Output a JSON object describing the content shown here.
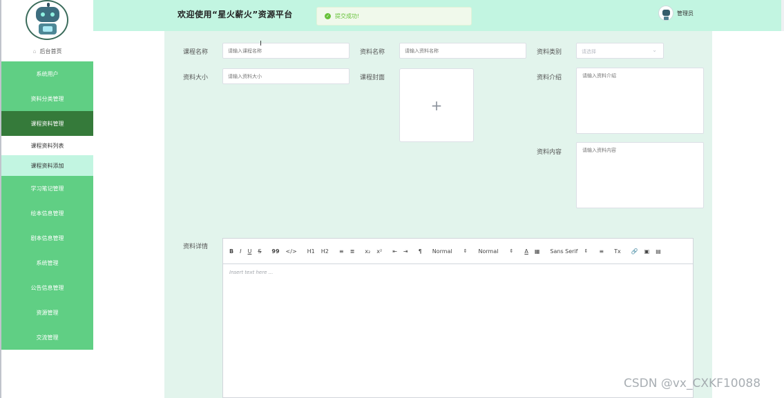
{
  "header": {
    "title": "欢迎使用“星火薪火”资源平台",
    "toast": "提交成功!",
    "user": "管理员"
  },
  "sidebar": {
    "home": "后台首页",
    "menu": [
      {
        "label": "系统用户"
      },
      {
        "label": "资料分类管理"
      },
      {
        "label": "课程资料管理"
      },
      {
        "label": "学习笔记管理"
      },
      {
        "label": "绘本信息管理"
      },
      {
        "label": "剧本信息管理"
      },
      {
        "label": "系统管理"
      },
      {
        "label": "公告信息管理"
      },
      {
        "label": "资源管理"
      },
      {
        "label": "交流管理"
      }
    ],
    "submenu": [
      {
        "label": "课程资料列表"
      },
      {
        "label": "课程资料添加"
      }
    ]
  },
  "form": {
    "course_name_label": "课程名称",
    "course_name_placeholder": "请输入课程名称",
    "material_name_label": "资料名称",
    "material_name_placeholder": "请输入资料名称",
    "category_label": "资料类别",
    "category_placeholder": "请选择",
    "size_label": "资料大小",
    "size_placeholder": "请输入资料大小",
    "cover_label": "课程封面",
    "intro_label": "资料介绍",
    "intro_placeholder": "请输入资料介绍",
    "content_label": "资料内容",
    "content_placeholder": "请输入资料内容",
    "detail_label": "资料详情"
  },
  "editor": {
    "placeholder": "Insert text here ...",
    "header_select": "Normal",
    "size_select": "Normal",
    "font_select": "Sans Serif",
    "tools": {
      "bold": "B",
      "italic": "I",
      "underline": "U",
      "strike": "S",
      "quote": "99",
      "code": "</>",
      "h1": "H1",
      "h2": "H2",
      "ol": "≡",
      "ul": "≣",
      "sub": "x₂",
      "sup": "x²",
      "outdent": "⇤",
      "indent": "⇥",
      "direction": "¶",
      "color": "A",
      "background": "▦",
      "align": "≡",
      "clean": "Tx",
      "link": "🔗",
      "image": "▣",
      "video": "▤"
    }
  },
  "watermark": "CSDN @vx_CXKF10088"
}
